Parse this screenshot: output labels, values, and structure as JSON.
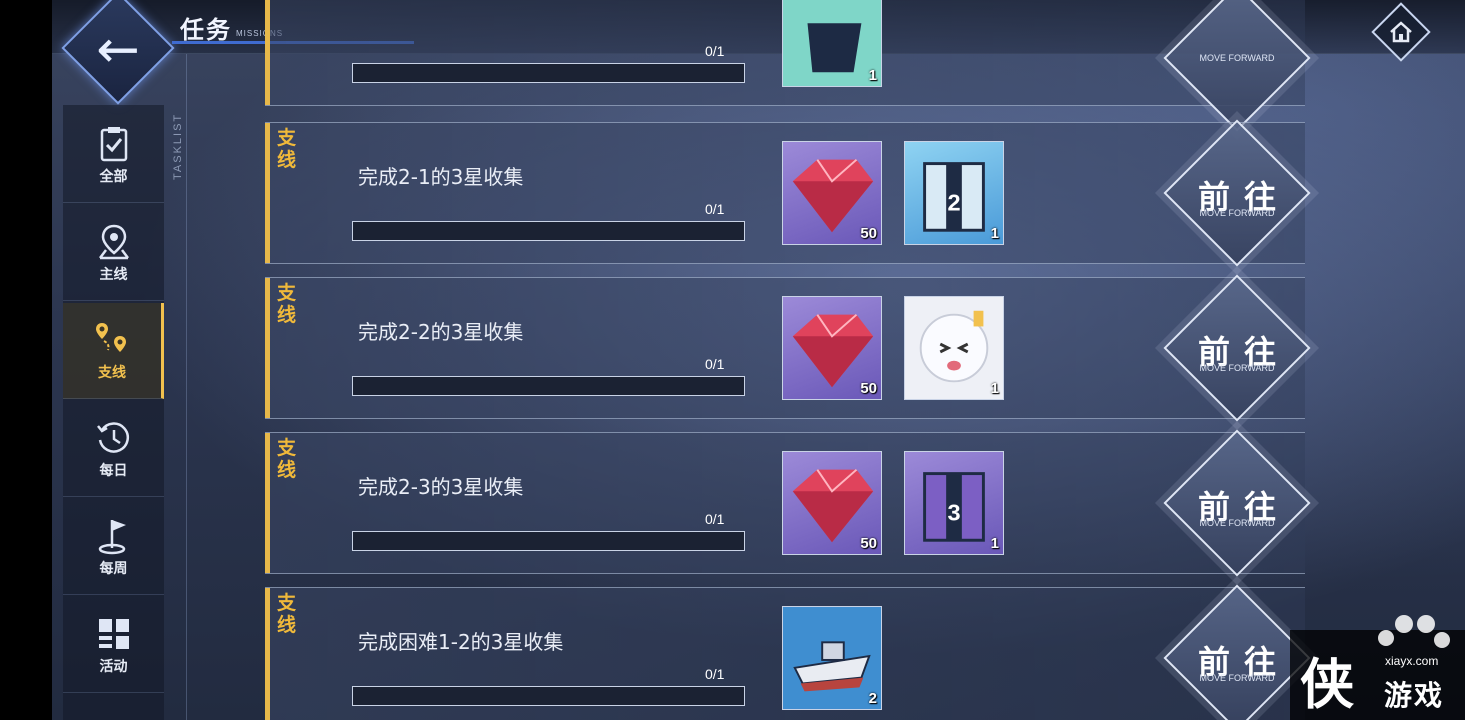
{
  "header": {
    "title": "任务",
    "subtitle": "MISSIONS",
    "back_icon": "back-arrow-icon",
    "home_icon": "home-icon"
  },
  "sidebar": {
    "side_label": "TASKLIST",
    "items": [
      {
        "label": "全部",
        "icon": "clipboard-icon",
        "active": false
      },
      {
        "label": "主线",
        "icon": "map-pin-icon",
        "active": false
      },
      {
        "label": "支线",
        "icon": "route-pins-icon",
        "active": true
      },
      {
        "label": "每日",
        "icon": "history-clock-icon",
        "active": false
      },
      {
        "label": "每周",
        "icon": "flag-icon",
        "active": false
      },
      {
        "label": "活动",
        "icon": "event-grid-icon",
        "active": false
      }
    ]
  },
  "missions": [
    {
      "tag": "",
      "title": "",
      "progress_text": "0/1",
      "progress": 0,
      "rewards": [
        {
          "item": "ship-icon",
          "count": "1"
        }
      ],
      "go_label": "前往",
      "go_sub": "MOVE FORWARD"
    },
    {
      "tag": "支线",
      "title": "完成2-1的3星收集",
      "progress_text": "0/1",
      "progress": 0,
      "rewards": [
        {
          "item": "ruby-icon",
          "count": "50"
        },
        {
          "item": "tech-box-2-icon",
          "count": "1"
        }
      ],
      "go_label": "前往",
      "go_sub": "MOVE FORWARD"
    },
    {
      "tag": "支线",
      "title": "完成2-2的3星收集",
      "progress_text": "0/1",
      "progress": 0,
      "rewards": [
        {
          "item": "ruby-icon",
          "count": "50"
        },
        {
          "item": "character-portrait-icon",
          "count": "1"
        }
      ],
      "go_label": "前往",
      "go_sub": "MOVE FORWARD"
    },
    {
      "tag": "支线",
      "title": "完成2-3的3星收集",
      "progress_text": "0/1",
      "progress": 0,
      "rewards": [
        {
          "item": "ruby-icon",
          "count": "50"
        },
        {
          "item": "tech-box-3-icon",
          "count": "1"
        }
      ],
      "go_label": "前往",
      "go_sub": "MOVE FORWARD"
    },
    {
      "tag": "支线",
      "title": "完成困难1-2的3星收集",
      "progress_text": "0/1",
      "progress": 0,
      "rewards": [
        {
          "item": "warship-icon",
          "count": "2"
        }
      ],
      "go_label": "前往",
      "go_sub": "MOVE FORWARD"
    }
  ],
  "watermark": {
    "char": "侠",
    "site": "xiayx.com",
    "name": "游戏"
  },
  "colors": {
    "accent_gold": "#e7b84a",
    "highlight_blue": "#7fa0e6",
    "reward_purple": "#8a78cc"
  }
}
